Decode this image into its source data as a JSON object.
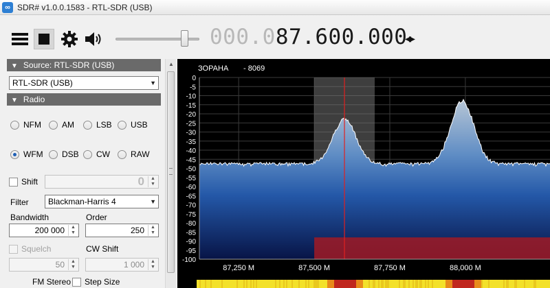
{
  "window": {
    "title": "SDR# v1.0.0.1583 - RTL-SDR (USB)",
    "app_icon": "sdrsharp-logo"
  },
  "toolbar": {
    "menu_icon": "hamburger-menu-icon",
    "stop_icon": "stop-icon",
    "settings_icon": "gear-icon",
    "audio_icon": "speaker-icon",
    "volume_level": 0.85,
    "frequency_dim": "000.0",
    "frequency_bright": "87.600.000",
    "tune_arrows": "◂▸"
  },
  "source": {
    "header": "Source: RTL-SDR (USB)",
    "device": "RTL-SDR (USB)"
  },
  "radio": {
    "header": "Radio",
    "modes_row1": [
      "NFM",
      "AM",
      "LSB",
      "USB"
    ],
    "modes_row2": [
      "WFM",
      "DSB",
      "CW",
      "RAW"
    ],
    "selected_mode": "WFM",
    "shift_label": "Shift",
    "shift_value": "0",
    "filter_label": "Filter",
    "filter_value": "Blackman-Harris 4",
    "bandwidth_label": "Bandwidth",
    "bandwidth_value": "200 000",
    "order_label": "Order",
    "order_value": "250",
    "squelch_label": "Squelch",
    "squelch_value": "50",
    "cw_shift_label": "CW Shift",
    "cw_shift_value": "1 000",
    "fm_stereo_label": "FM Stereo",
    "step_size_label": "Step Size"
  },
  "chart_data": {
    "type": "line",
    "station_name": "ЗОРАНА",
    "station_code": "- 8069",
    "ylim": [
      -100,
      0
    ],
    "y_ticks": [
      0,
      -5,
      -10,
      -15,
      -20,
      -25,
      -30,
      -35,
      -40,
      -45,
      -50,
      -55,
      -60,
      -65,
      -70,
      -75,
      -80,
      -85,
      -90,
      -95,
      -100
    ],
    "xlim": [
      87.12,
      88.28
    ],
    "x_ticks": [
      87.25,
      87.5,
      87.75,
      88.0
    ],
    "x_tick_labels": [
      "87,250 M",
      "87,500 M",
      "87,750 M",
      "88,000 M"
    ],
    "tuned_frequency": 87.6,
    "filter_band": [
      87.5,
      87.7
    ],
    "noise_floor": -48,
    "peaks": [
      {
        "center": 87.6,
        "level": -23
      },
      {
        "center": 87.99,
        "level": -13
      }
    ],
    "colors": {
      "fill_top": "#8fa8c2",
      "fill_mid": "#2c66b8",
      "fill_bottom": "#0a1d5a",
      "tune_line": "#e02020",
      "filter_band": "#7c7c7c",
      "bottom_band": "#a01a24"
    }
  }
}
